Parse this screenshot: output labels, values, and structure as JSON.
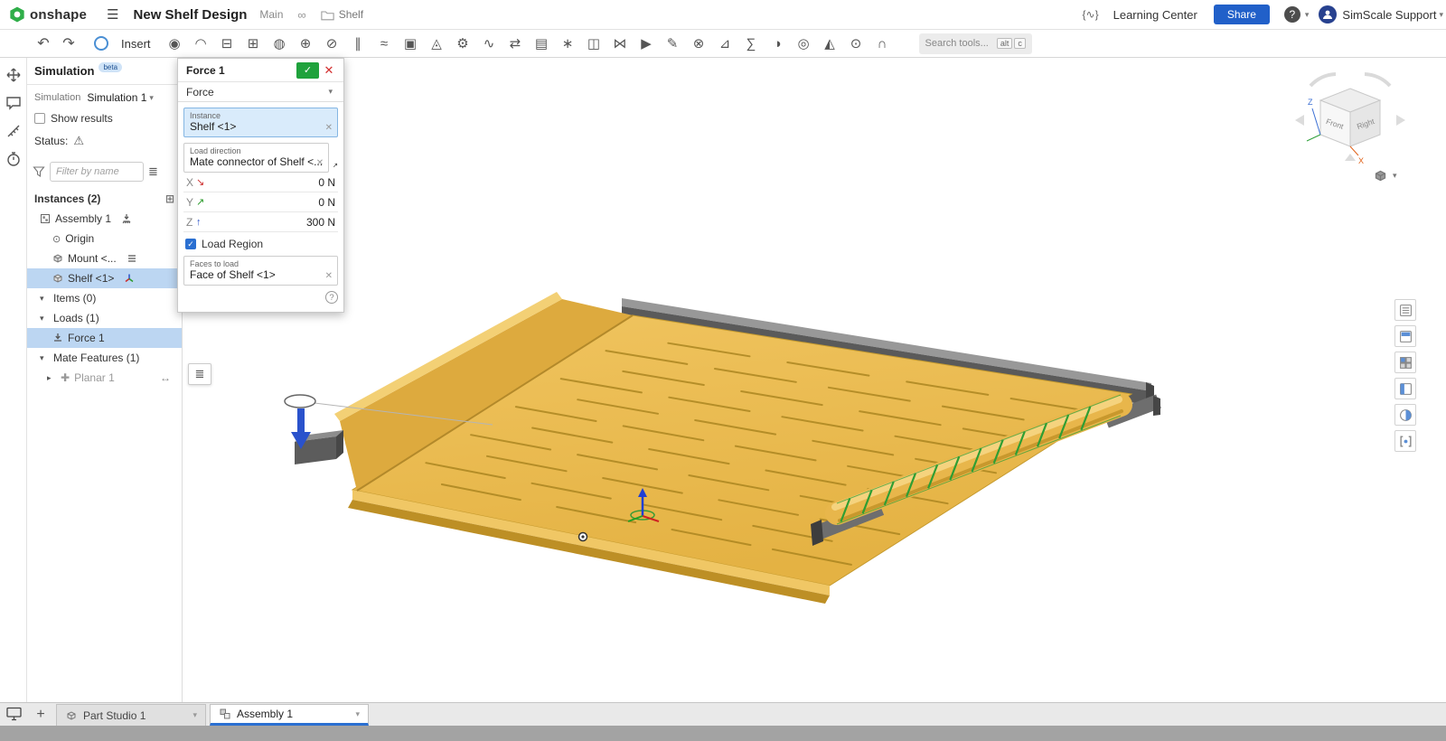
{
  "colors": {
    "accent": "#2a6fd1",
    "selection": "#bcd6f2",
    "share_button": "#2160c9",
    "confirm_green": "#1fa23c",
    "cancel_red": "#d32f2f",
    "shelf_yellow": "#ecbd55",
    "rail_gray": "#6e6e6e",
    "load_arrow_blue": "#2a52cc",
    "mate_highlight_green": "#2f9e33"
  },
  "icons": {
    "menu": "☰",
    "link": "∞",
    "featurescript": "{∿}",
    "help": "?",
    "caret": "▾",
    "caret_right": "▸",
    "undo": "↶",
    "redo": "↷",
    "plus": "+",
    "check": "✓",
    "clear": "✕",
    "warning": "⚠",
    "list": "≣",
    "origin": "⊙",
    "planar_cross": "✚",
    "slider": "↔",
    "insert_instance": "⊞"
  },
  "topbar": {
    "logo": "onshape",
    "title": "New Shelf Design",
    "workspace": "Main",
    "doc": "Shelf",
    "learning_center": "Learning Center",
    "share": "Share",
    "account": "SimScale Support"
  },
  "toolbar": {
    "insert": "Insert",
    "search": "Search tools...",
    "kbd_alt": "alt",
    "kbd_c": "c",
    "icons": [
      {
        "name": "fasten-mate-icon",
        "glyph": "◉"
      },
      {
        "name": "revolute-mate-icon",
        "glyph": "◠"
      },
      {
        "name": "slider-mate-icon",
        "glyph": "⊟"
      },
      {
        "name": "planar-mate-icon",
        "glyph": "⊞"
      },
      {
        "name": "ball-mate-icon",
        "glyph": "◍"
      },
      {
        "name": "cylindrical-mate-icon",
        "glyph": "⊕"
      },
      {
        "name": "pin-slot-mate-icon",
        "glyph": "⊘"
      },
      {
        "name": "parallel-mate-icon",
        "glyph": "∥"
      },
      {
        "name": "tangent-mate-icon",
        "glyph": "≈"
      },
      {
        "name": "group-icon",
        "glyph": "▣"
      },
      {
        "name": "mate-connector-icon",
        "glyph": "◬"
      },
      {
        "name": "gear-relation-icon",
        "glyph": "⚙"
      },
      {
        "name": "screw-relation-icon",
        "glyph": "∿"
      },
      {
        "name": "linear-relation-icon",
        "glyph": "⇄"
      },
      {
        "name": "bom-table-icon",
        "glyph": "▤"
      },
      {
        "name": "exploded-view-icon",
        "glyph": "∗"
      },
      {
        "name": "snapshot-icon",
        "glyph": "◫"
      },
      {
        "name": "named-positions-icon",
        "glyph": "⋈"
      },
      {
        "name": "animate-icon",
        "glyph": "▶"
      },
      {
        "name": "drawing-icon",
        "glyph": "✎"
      },
      {
        "name": "interference-icon",
        "glyph": "⊗"
      },
      {
        "name": "measure-tool-icon",
        "glyph": "⊿"
      },
      {
        "name": "mass-properties-icon",
        "glyph": "∑"
      },
      {
        "name": "appearance-icon",
        "glyph": "◑"
      },
      {
        "name": "hole-icon",
        "glyph": "◎"
      },
      {
        "name": "section-view-icon",
        "glyph": "◭"
      },
      {
        "name": "lens-icon",
        "glyph": "⊙"
      },
      {
        "name": "vr-view-icon",
        "glyph": "∩"
      }
    ]
  },
  "sim_panel": {
    "title": "Simulation",
    "beta": "beta",
    "sim_label": "Simulation",
    "sim_value": "Simulation 1",
    "show_results": "Show results",
    "status": "Status:",
    "filter_placeholder": "Filter by name",
    "instances_header": "Instances (2)",
    "instances": [
      {
        "label": "Assembly 1"
      },
      {
        "label": "Origin"
      },
      {
        "label": "Mount <..."
      },
      {
        "label": "Shelf <1>"
      }
    ],
    "items_header": "Items (0)",
    "loads_header": "Loads (1)",
    "force_item": "Force 1",
    "mate_header": "Mate Features (1)",
    "planar_item": "Planar 1"
  },
  "dialog": {
    "title": "Force 1",
    "type": "Force",
    "instance_label": "Instance",
    "instance_value": "Shelf <1>",
    "direction_label": "Load direction",
    "direction_value": "Mate connector of Shelf <...",
    "x_label": "X",
    "x_arrow": "↘",
    "x_value": "0 N",
    "y_label": "Y",
    "y_arrow": "↗",
    "y_value": "0 N",
    "z_label": "Z",
    "z_arrow": "↑",
    "z_value": "300 N",
    "load_region": "Load Region",
    "faces_label": "Faces to load",
    "faces_value": "Face of Shelf <1>"
  },
  "viewcube": {
    "front": "Front",
    "right": "Right",
    "z": "Z",
    "x": "X"
  },
  "tabs": [
    {
      "label": "Part Studio 1",
      "active": false
    },
    {
      "label": "Assembly 1",
      "active": true
    }
  ]
}
